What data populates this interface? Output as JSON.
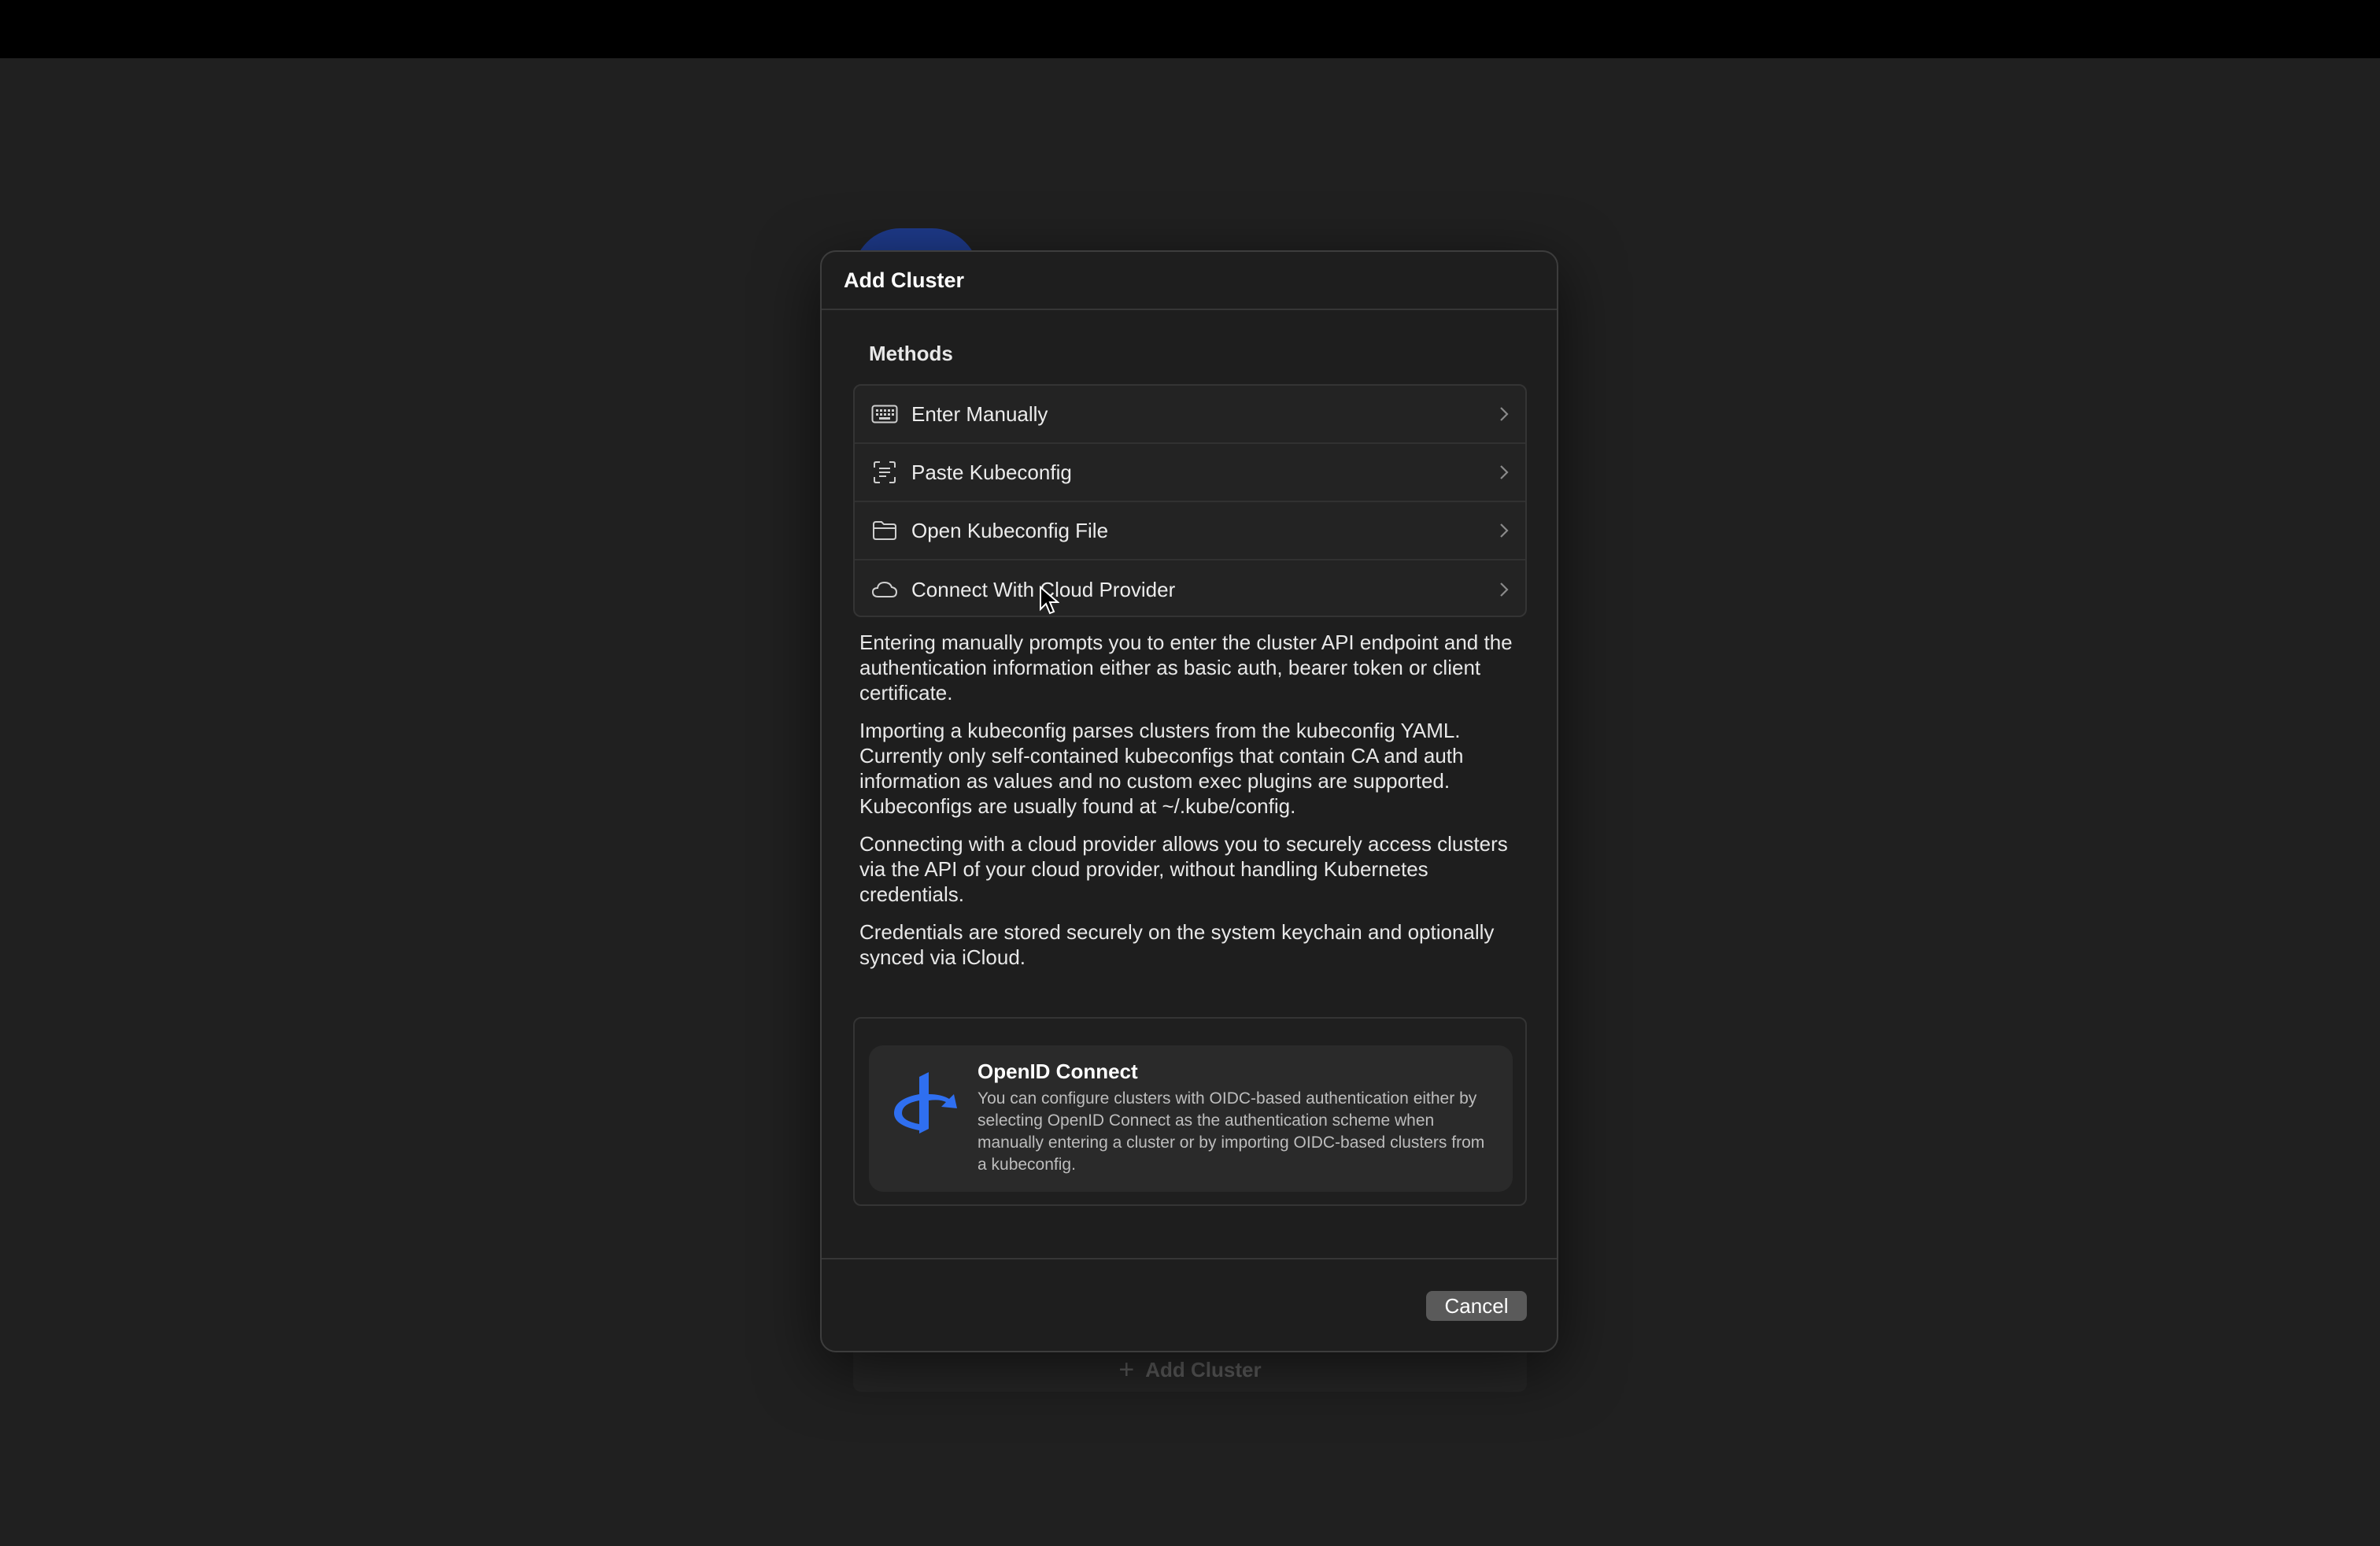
{
  "dialog": {
    "title": "Add Cluster",
    "methods_label": "Methods",
    "methods": [
      {
        "label": "Enter Manually",
        "icon": "keyboard-icon"
      },
      {
        "label": "Paste Kubeconfig",
        "icon": "paste-scan-icon"
      },
      {
        "label": "Open Kubeconfig File",
        "icon": "folder-icon"
      },
      {
        "label": "Connect With Cloud Provider",
        "icon": "cloud-icon"
      }
    ],
    "descriptions": [
      "Entering manually prompts you to enter the cluster API endpoint and the authentication information either as basic auth, bearer token or client certificate.",
      "Importing a kubeconfig parses clusters from the kubeconfig YAML. Currently only self-contained kubeconfigs that contain CA and auth information as values and no custom exec plugins are supported. Kubeconfigs are usually found at ~/.kube/config.",
      "Connecting with a cloud provider allows you to securely access clusters via the API of your cloud provider, without handling Kubernetes credentials.",
      "Credentials are stored securely on the system keychain and optionally synced via iCloud."
    ],
    "oidc": {
      "title": "OpenID Connect",
      "body": "You can configure clusters with OIDC-based authentication either by selecting OpenID Connect as the authentication scheme when manually entering a cluster or by importing OIDC-based clusters from a kubeconfig.",
      "icon": "openid-logo-icon"
    },
    "cancel_label": "Cancel"
  },
  "background": {
    "add_cluster_label": "Add Cluster"
  },
  "colors": {
    "openid_blue": "#2f6ff0",
    "cancel_button": "#5a5a5a"
  }
}
